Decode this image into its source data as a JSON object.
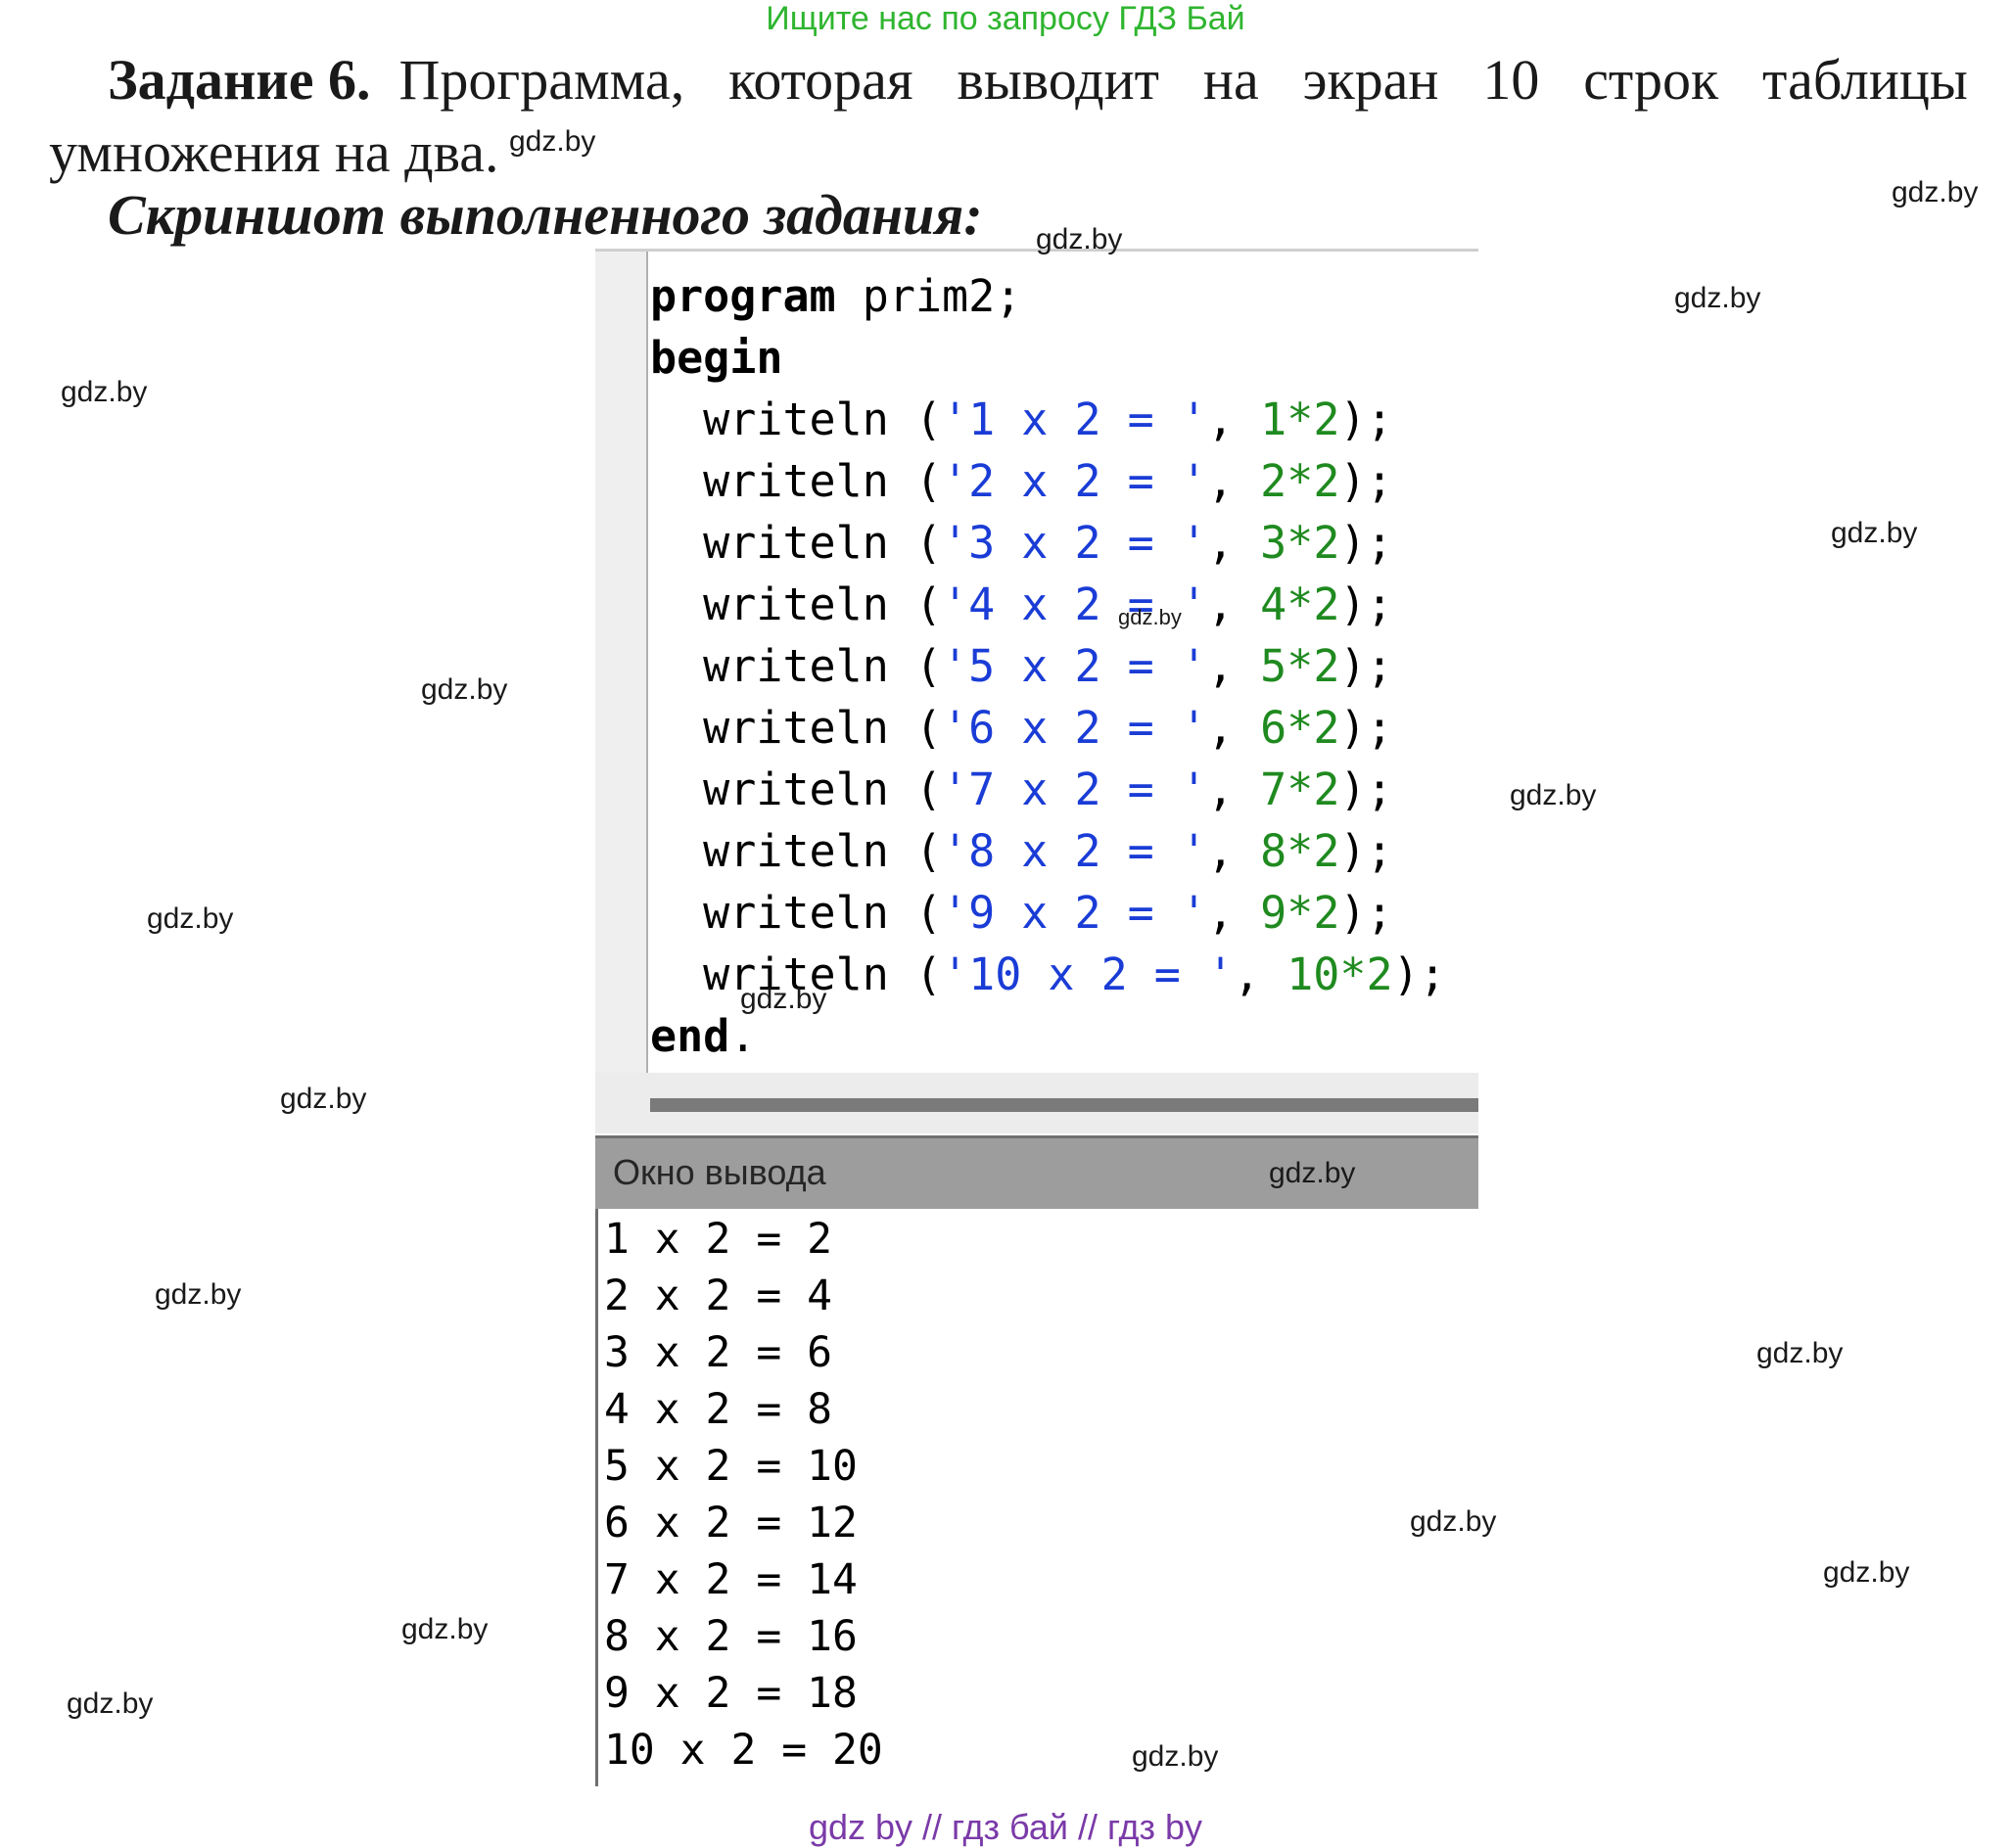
{
  "header": {
    "banner": "Ищите нас по запросу ГДЗ Бай"
  },
  "task": {
    "title_bold": "Задание 6.",
    "line1_words": [
      "Программа,",
      "которая",
      "выводит",
      "на",
      "экран",
      "10",
      "строк",
      "таблицы"
    ],
    "line2": "умножения на два.",
    "subtitle": "Скриншот выполненного задания:"
  },
  "editor": {
    "lines": [
      "program prim2;",
      "begin",
      "  writeln ('1 x 2 = ', 1*2);",
      "  writeln ('2 x 2 = ', 2*2);",
      "  writeln ('3 x 2 = ', 3*2);",
      "  writeln ('4 x 2 = ', 4*2);",
      "  writeln ('5 x 2 = ', 5*2);",
      "  writeln ('6 x 2 = ', 6*2);",
      "  writeln ('7 x 2 = ', 7*2);",
      "  writeln ('8 x 2 = ', 8*2);",
      "  writeln ('9 x 2 = ', 9*2);",
      "  writeln ('10 x 2 = ', 10*2);",
      "end."
    ]
  },
  "output_window": {
    "title": "Окно вывода",
    "lines": [
      "1 x 2 = 2",
      "2 x 2 = 4",
      "3 x 2 = 6",
      "4 x 2 = 8",
      "5 x 2 = 10",
      "6 x 2 = 12",
      "7 x 2 = 14",
      "8 x 2 = 16",
      "9 x 2 = 18",
      "10 x 2 = 20"
    ]
  },
  "watermark": "gdz.by",
  "footer": {
    "banner": "gdz by  //  гдз бай  //  гдз by"
  }
}
